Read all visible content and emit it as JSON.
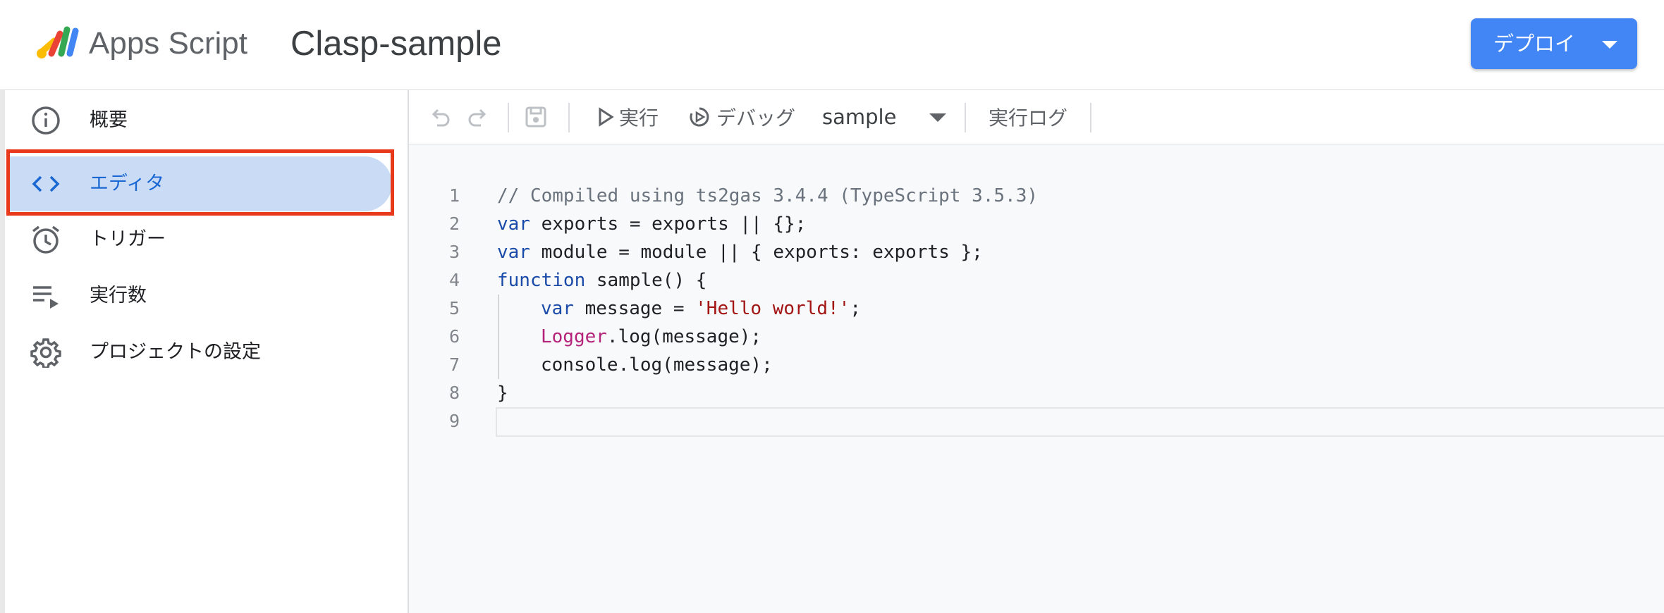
{
  "header": {
    "app_name": "Apps Script",
    "project_name": "Clasp-sample",
    "deploy_label": "デプロイ"
  },
  "sidebar": {
    "items": [
      {
        "label": "概要",
        "icon": "info-icon"
      },
      {
        "label": "エディタ",
        "icon": "code-icon",
        "active": true
      },
      {
        "label": "トリガー",
        "icon": "alarm-icon"
      },
      {
        "label": "実行数",
        "icon": "executions-icon"
      },
      {
        "label": "プロジェクトの設定",
        "icon": "gear-icon"
      }
    ]
  },
  "toolbar": {
    "run_label": "実行",
    "debug_label": "デバッグ",
    "function_selected": "sample",
    "log_label": "実行ログ"
  },
  "editor": {
    "line_numbers": [
      "1",
      "2",
      "3",
      "4",
      "5",
      "6",
      "7",
      "8",
      "9"
    ],
    "code": {
      "l1": "// Compiled using ts2gas 3.4.4 (TypeScript 3.5.3)",
      "kw_var": "var",
      "l2_rest": " exports = exports || {};",
      "l3_rest": " module = module || { exports: exports };",
      "kw_function": "function",
      "l4_rest": " sample() {",
      "l5_rest": " message = ",
      "l5_str": "'Hello world!'",
      "semicolon": ";",
      "l6_cls": "Logger",
      "l6_rest": ".log(message);",
      "l7": "console.log(message);",
      "l8": "}"
    }
  },
  "colors": {
    "accent_blue": "#4285f4",
    "active_nav_bg": "#c9dbf5",
    "highlight_red": "#e8391b"
  }
}
